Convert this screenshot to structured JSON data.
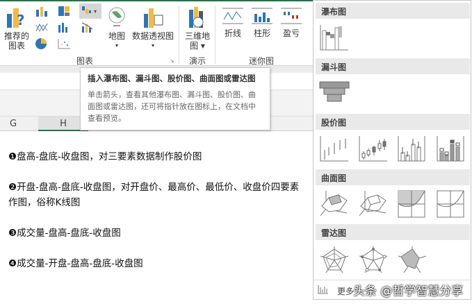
{
  "ribbon": {
    "recommended": "推荐的\n图表",
    "recommended_l1": "推荐的",
    "recommended_l2": "图表",
    "map": "地图",
    "pivot_chart": "数据透视图",
    "map3d_l1": "三维地",
    "map3d_l2": "图 ▾",
    "sparkline_line": "折线",
    "sparkline_column": "柱形",
    "sparkline_winloss": "盈亏",
    "group_charts": "图表",
    "group_tours": "演示",
    "group_sparklines": "迷你图"
  },
  "tooltip": {
    "title": "插入瀑布图、漏斗图、股价图、曲面图或雷达图",
    "description": "单击箭头，查看其他瀑布图、漏斗图、股价图、曲面图或雷达图，还可将指针放在图标上，在文档中查看预览。"
  },
  "columns": [
    "G",
    "H"
  ],
  "document": {
    "lines": [
      "❶盘高-盘底-收盘图，对三要素数据制作股价图",
      "❷开盘-盘高-盘底-收盘图，对开盘价、最高价、最低价、收盘价四要素作图，俗称K线图",
      "❸成交量-盘高-盘底-收盘图",
      "❹成交量-开盘-盘高-盘底-收盘图"
    ]
  },
  "panel": {
    "sections": [
      "瀑布图",
      "漏斗图",
      "股价图",
      "曲面图",
      "雷达图"
    ],
    "more_label": "更多"
  },
  "watermark": "头条 @哲学智慧分享"
}
